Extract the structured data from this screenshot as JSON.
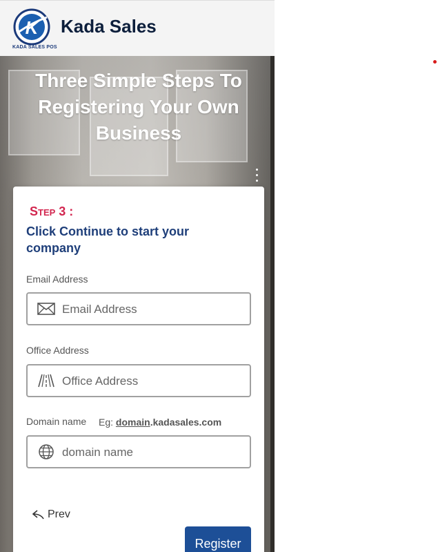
{
  "header": {
    "logo_letter": "K",
    "logo_caption": "KADA SALES POS",
    "brand_name": "Kada Sales"
  },
  "hero": {
    "title": "Three Simple Steps To Registering Your Own Business"
  },
  "form": {
    "step_label": "Step 3 :",
    "subtitle": "Click Continue to start your company",
    "email": {
      "label": "Email Address",
      "placeholder": "Email Address",
      "value": "",
      "icon": "envelope-icon"
    },
    "office": {
      "label": "Office Address",
      "placeholder": "Office Address",
      "value": "",
      "icon": "road-icon"
    },
    "domain": {
      "label": "Domain name",
      "hint_prefix": "Eg:",
      "hint_domain": "domain",
      "hint_suffix": ".kadasales.com",
      "placeholder": "domain name",
      "value": "",
      "icon": "globe-icon"
    },
    "prev_label": "Prev",
    "register_label": "Register"
  },
  "colors": {
    "accent": "#1d4f97",
    "step": "#d2264f",
    "subtitle": "#1f3f7a"
  }
}
